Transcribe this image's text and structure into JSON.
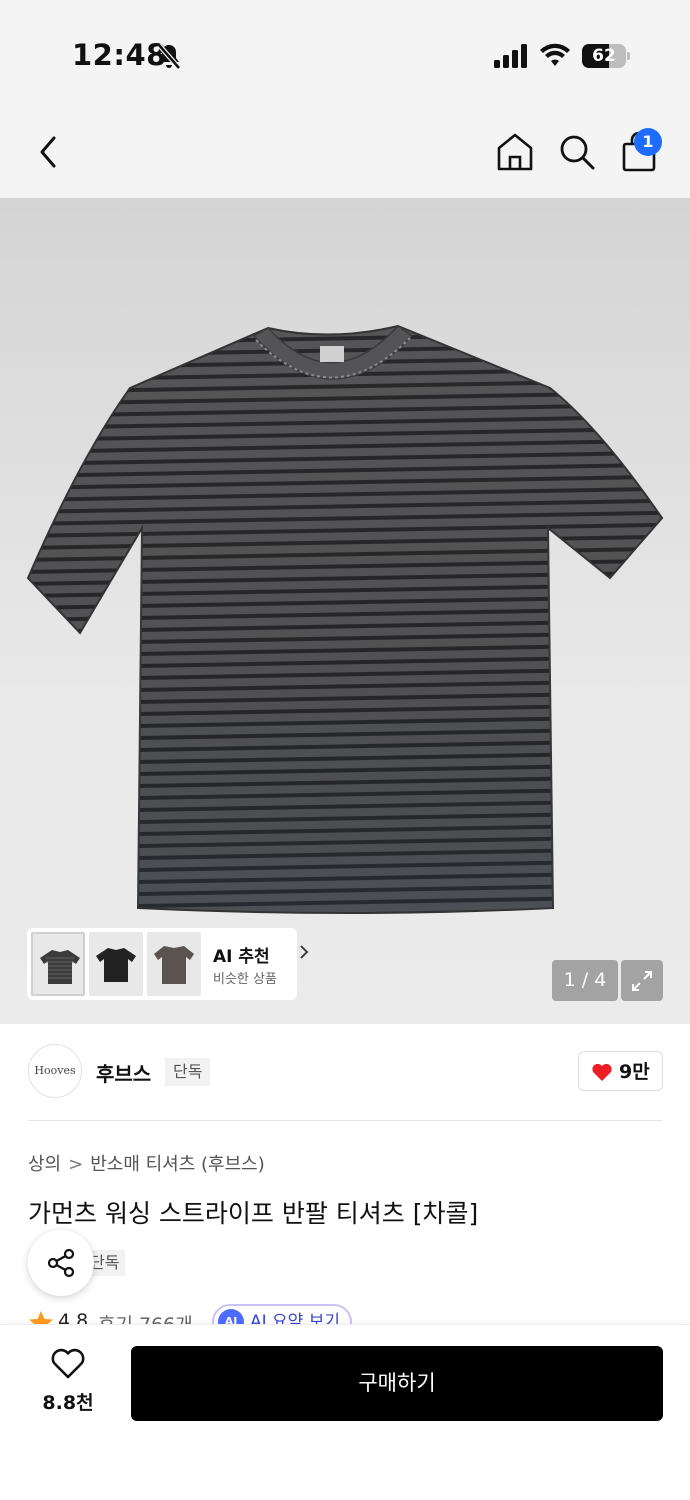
{
  "status_bar": {
    "time": "12:48",
    "battery_level": "62",
    "battery_fraction": 0.62
  },
  "nav": {
    "cart_count": "1",
    "accent_color": "#1f6bff"
  },
  "gallery": {
    "ai_recommend_title": "AI 추천",
    "ai_recommend_sub": "비슷한 상품",
    "page_indicator": "1 / 4",
    "thumbnails": [
      "striped-tee-thumb",
      "black-tee-thumb",
      "brown-tee-thumb"
    ]
  },
  "brand": {
    "logo_text": "Hooves",
    "name": "후브스",
    "tag": "단독",
    "likes": "9만"
  },
  "product": {
    "breadcrumb": [
      "상의",
      "반소매 티셔츠 (후브스)"
    ],
    "title": "가먼츠 워싱 스트라이프 반팔 티셔츠 [차콜]",
    "exclusive_tag": "단독",
    "rating": "4.8",
    "reviews": "후기 766개",
    "ai_summary_badge": "AI",
    "ai_summary_label": "AI 요약 보기"
  },
  "bottom_bar": {
    "wish_count": "8.8천",
    "buy_label": "구매하기"
  }
}
